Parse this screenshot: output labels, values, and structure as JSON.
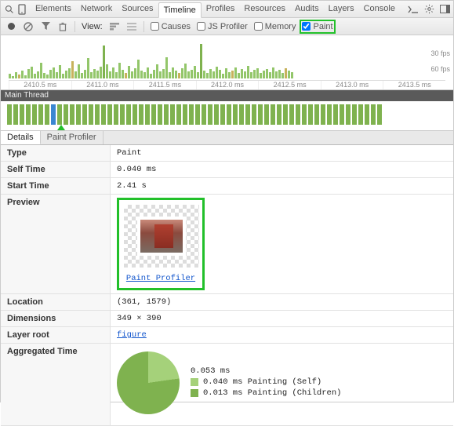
{
  "top": {
    "tabs": [
      "Elements",
      "Network",
      "Sources",
      "Timeline",
      "Profiles",
      "Resources",
      "Audits",
      "Layers",
      "Console"
    ],
    "active": "Timeline"
  },
  "toolbar": {
    "view_label": "View:",
    "causes": "Causes",
    "js_profiler": "JS Profiler",
    "memory": "Memory",
    "paint": "Paint"
  },
  "overview": {
    "fps30": "30 fps",
    "fps60": "60 fps",
    "ticks": [
      "2410.5 ms",
      "2411.0 ms",
      "2411.5 ms",
      "2412.0 ms",
      "2412.5 ms",
      "2413.0 ms",
      "2413.5 ms"
    ]
  },
  "main_thread": {
    "label": "Main Thread"
  },
  "detail_tabs": {
    "items": [
      "Details",
      "Paint Profiler"
    ],
    "active": "Details"
  },
  "props": {
    "type_k": "Type",
    "type_v": "Paint",
    "self_k": "Self Time",
    "self_v": "0.040 ms",
    "start_k": "Start Time",
    "start_v": "2.41 s",
    "preview_k": "Preview",
    "preview_link": "Paint Profiler",
    "location_k": "Location",
    "location_v": "(361, 1579)",
    "dimensions_k": "Dimensions",
    "dimensions_v": "349 × 390",
    "layer_k": "Layer root",
    "layer_v": "figure",
    "agg_k": "Aggregated Time",
    "agg_total": "0.053 ms",
    "agg_self": "0.040 ms Painting (Self)",
    "agg_children": "0.013 ms Painting (Children)"
  },
  "chart_data": {
    "type": "pie",
    "title": "Aggregated Time",
    "series": [
      {
        "name": "Painting (Self)",
        "value_ms": 0.04
      },
      {
        "name": "Painting (Children)",
        "value_ms": 0.013
      }
    ],
    "total_ms": 0.053
  }
}
